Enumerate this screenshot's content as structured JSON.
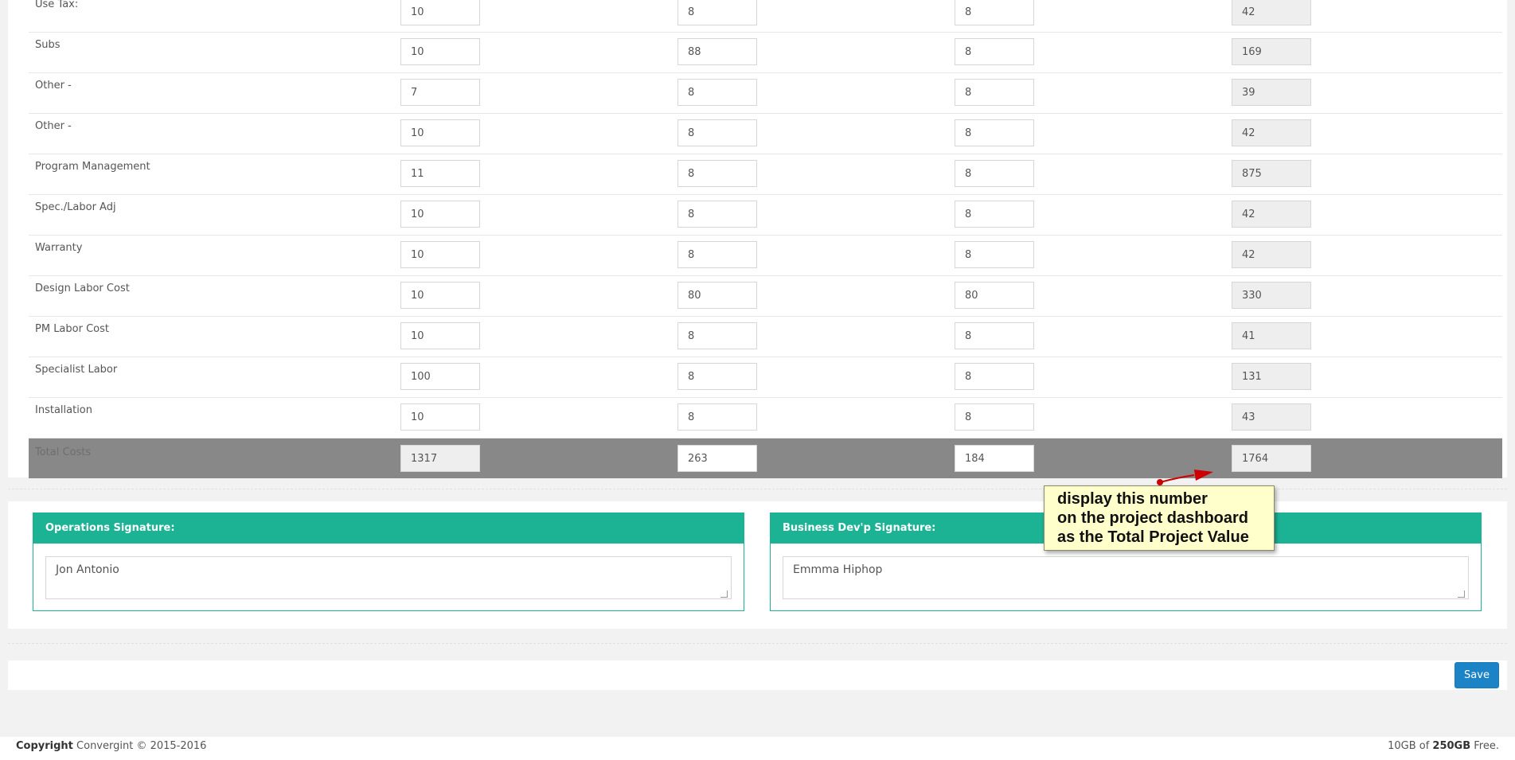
{
  "rows": [
    {
      "label": "Use Tax:",
      "v1": "10",
      "v2": "8",
      "v3": "8",
      "total": "42"
    },
    {
      "label": "Subs",
      "v1": "10",
      "v2": "88",
      "v3": "8",
      "total": "169"
    },
    {
      "label": "Other -",
      "v1": "7",
      "v2": "8",
      "v3": "8",
      "total": "39"
    },
    {
      "label": "Other -",
      "v1": "10",
      "v2": "8",
      "v3": "8",
      "total": "42"
    },
    {
      "label": "Program Management",
      "v1": "11",
      "v2": "8",
      "v3": "8",
      "total": "875"
    },
    {
      "label": "Spec./Labor Adj",
      "v1": "10",
      "v2": "8",
      "v3": "8",
      "total": "42"
    },
    {
      "label": "Warranty",
      "v1": "10",
      "v2": "8",
      "v3": "8",
      "total": "42"
    },
    {
      "label": "Design Labor Cost",
      "v1": "10",
      "v2": "80",
      "v3": "80",
      "total": "330"
    },
    {
      "label": "PM Labor Cost",
      "v1": "10",
      "v2": "8",
      "v3": "8",
      "total": "41"
    },
    {
      "label": "Specialist Labor",
      "v1": "100",
      "v2": "8",
      "v3": "8",
      "total": "131"
    },
    {
      "label": "Installation",
      "v1": "10",
      "v2": "8",
      "v3": "8",
      "total": "43"
    }
  ],
  "totals": {
    "label": "Total Costs",
    "v1": "1317",
    "v2": "263",
    "v3": "184",
    "total": "1764"
  },
  "signatures": {
    "operations": {
      "title": "Operations Signature:",
      "value": "Jon Antonio"
    },
    "business": {
      "title": "Business Dev'p Signature:",
      "value": "Emmma Hiphop"
    }
  },
  "save_label": "Save",
  "footer": {
    "copyright_bold": "Copyright",
    "copyright_text": " Convergint © 2015-2016",
    "storage_used": "10GB of ",
    "storage_total": "250GB",
    "storage_suffix": " Free."
  },
  "callout": {
    "line1": "display this number",
    "line2": "on the project dashboard",
    "line3": "as the Total Project Value"
  },
  "colors": {
    "accent_green": "#1bb394",
    "save_blue": "#1c84c6",
    "total_row_gray": "#888888",
    "callout_bg": "#ffffcc",
    "arrow_red": "#cc0000"
  }
}
